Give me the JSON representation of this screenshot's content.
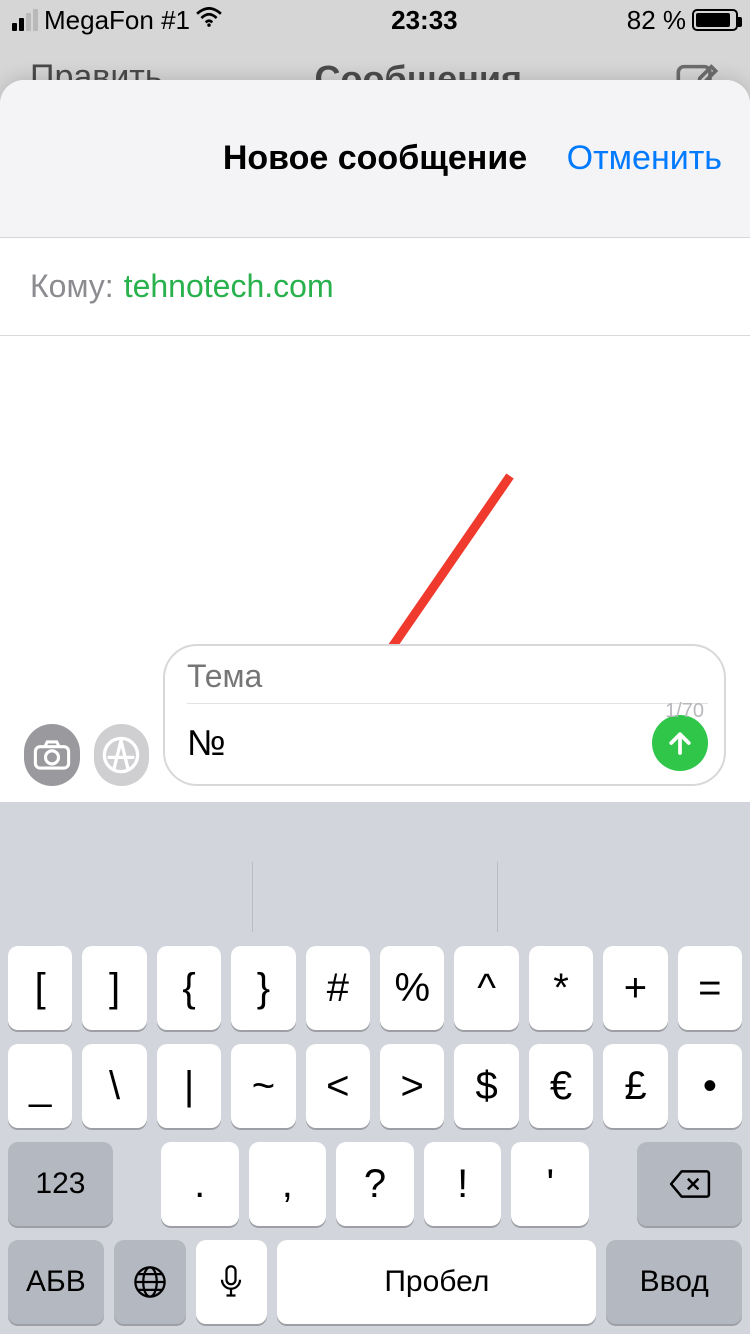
{
  "status": {
    "carrier": "MegaFon #1",
    "time": "23:33",
    "battery_text": "82 %"
  },
  "bg": {
    "title": "Сообщения",
    "edit": "Править"
  },
  "sheet": {
    "title": "Новое сообщение",
    "cancel": "Отменить"
  },
  "compose": {
    "to_label": "Кому:",
    "to_value": "tehnotech.com",
    "subject_placeholder": "Тема",
    "body_value": "№",
    "counter": "1/70"
  },
  "keyboard": {
    "row1": [
      "[",
      "]",
      "{",
      "}",
      "#",
      "%",
      "^",
      "*",
      "+",
      "="
    ],
    "row2": [
      "_",
      "\\",
      "|",
      "~",
      "<",
      ">",
      "$",
      "€",
      "£",
      "•"
    ],
    "row3_num": "123",
    "row3_keys": [
      ".",
      ",",
      "?",
      "!",
      "'"
    ],
    "row4": {
      "abc": "АБВ",
      "space": "Пробел",
      "enter": "Ввод"
    }
  }
}
